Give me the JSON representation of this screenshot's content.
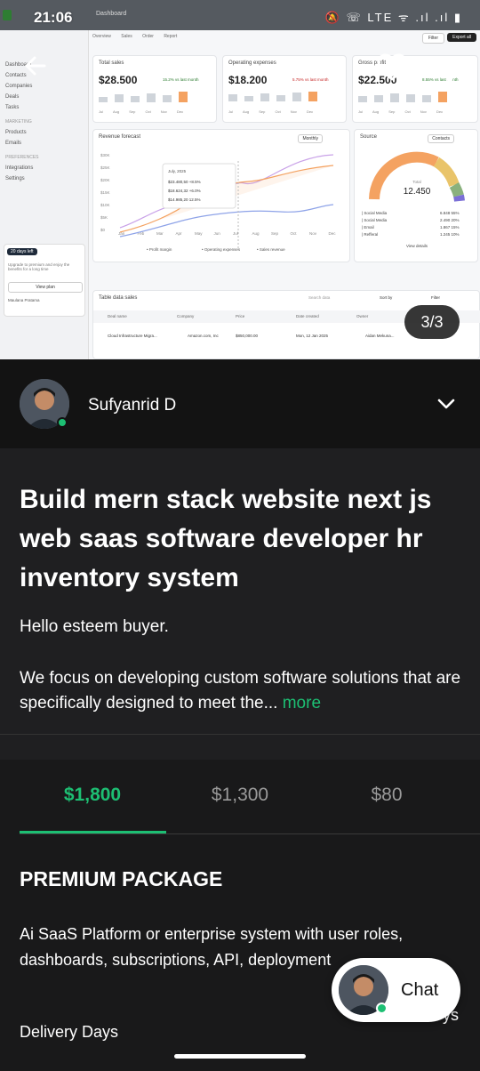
{
  "status_bar": {
    "time": "21:06",
    "icons": "🔕 ☏ LTE ᯤ .ıl .ıl ▮"
  },
  "gallery": {
    "counter": "3/3",
    "back_icon": "arrow-left-icon",
    "favorite_icon": "heart-icon",
    "more_icon": "more-vertical-icon",
    "dashboard_preview": {
      "header_crumb": "Dashboard",
      "tabs": [
        "Overview",
        "Sales",
        "Order",
        "Report"
      ],
      "filter_label": "Filter",
      "export_label": "Export all",
      "sidebar_sections": [
        {
          "label": "Dashboard"
        },
        {
          "label": "Contacts"
        },
        {
          "label": "Companies"
        },
        {
          "label": "Deals"
        },
        {
          "label": "Tasks"
        },
        {
          "head": "MARKETING"
        },
        {
          "label": "Products"
        },
        {
          "label": "Emails"
        },
        {
          "head": "PREFERENCES"
        },
        {
          "label": "Integrations"
        },
        {
          "label": "Settings"
        }
      ],
      "upgrade": {
        "badge": "20 days left",
        "text": "Upgrade to premium and enjoy the benefits for a long time",
        "button": "View plan",
        "user": "Maulana Pratama"
      },
      "kpis": [
        {
          "title": "Total sales",
          "value": "$28.500",
          "delta": "15.2% vs last month"
        },
        {
          "title": "Operating expenses",
          "value": "$18.200",
          "delta": "5.75% vs last month"
        },
        {
          "title": "Gross profit",
          "value": "$22.500",
          "delta": "8.55% vs last month"
        }
      ],
      "months_short": "Jul Aug Sep Oct Nov Dec",
      "revenue": {
        "title": "Revenue forecast",
        "period": "Monthly",
        "tooltip_date": "July, 2025",
        "tooltip_rows": [
          "$23.480,50 +8.5%",
          "$18.624,32 +6.0%",
          "$14.985,20 12.5%"
        ],
        "y_ticks": [
          "$30K",
          "$25K",
          "$20K",
          "$15K",
          "$10K",
          "$5K",
          "$0"
        ],
        "x_ticks": [
          "Jan",
          "Feb",
          "Mar",
          "Apr",
          "May",
          "Jun",
          "Jul",
          "Aug",
          "Sep",
          "Oct",
          "Nov",
          "Dec"
        ],
        "legend": [
          "Profit margin",
          "Operating expenses",
          "Sales revenue"
        ]
      },
      "source": {
        "title": "Source",
        "filter": "Contacts",
        "total_label": "Total",
        "total_value": "12.450",
        "rows": [
          {
            "name": "Social Media",
            "value": "6.848 55%"
          },
          {
            "name": "Social Media",
            "value": "2.490 20%"
          },
          {
            "name": "Email",
            "value": "1.867 15%"
          },
          {
            "name": "Refferal",
            "value": "1.245 10%"
          }
        ],
        "details": "View details"
      },
      "table": {
        "title": "Table data sales",
        "search": "Search data",
        "sort": "Sort by",
        "filter": "Filter",
        "headers": [
          "Deal name",
          "Company",
          "Price",
          "Date created",
          "Owner"
        ],
        "row": [
          "Cloud Infrastructure Migra...",
          "Amazon.com, Inc",
          "$850,000.00",
          "Mon, 12 Jan 2025",
          "Aidan Mekuna..."
        ]
      }
    }
  },
  "seller": {
    "name": "Sufyanrid D",
    "expand_icon": "chevron-down-icon"
  },
  "gig": {
    "title": "Build mern stack website next js web saas software developer hr inventory system",
    "greeting": "Hello esteem buyer.",
    "description": "We focus on developing custom software solutions that are specifically designed to meet the...",
    "more_label": "more"
  },
  "packages": {
    "tabs": [
      "$1,800",
      "$1,300",
      "$80"
    ],
    "selected_index": 0,
    "name": "PREMIUM PACKAGE",
    "description": "Ai SaaS Platform or enterprise system with user roles, dashboards, subscriptions, API, deployment",
    "delivery_label": "Delivery Days",
    "delivery_value_partial": "ys"
  },
  "chat_button": {
    "label": "Chat"
  },
  "colors": {
    "accent": "#1dbf73",
    "background": "#1f1f21",
    "seller_bar": "#131313"
  }
}
